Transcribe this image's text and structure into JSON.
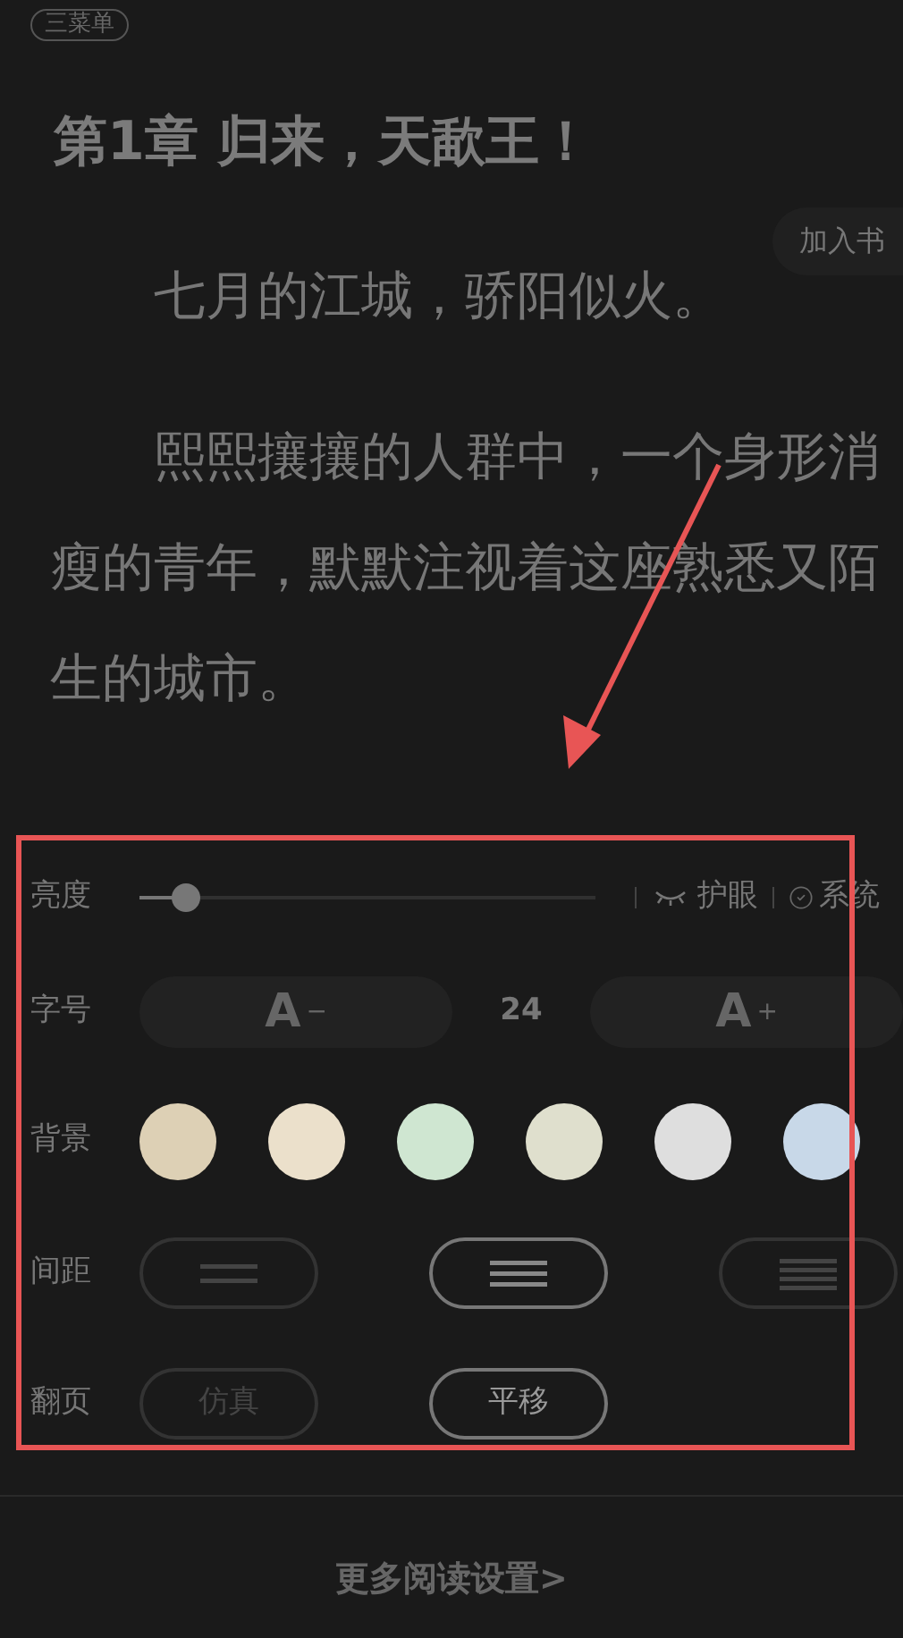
{
  "menu_button": {
    "label": "三菜单"
  },
  "chapter_title": "第1章 归来，天歃王！",
  "add_to_shelf_button": {
    "label": "加入书"
  },
  "paragraphs": [
    "七月的江城，骄阳似火。",
    "熙熙攘攘的人群中，一个身形消瘦的青年，默默注视着这座熟悉又陌生的城市。"
  ],
  "settings": {
    "brightness": {
      "label": "亮度",
      "level": 0.1,
      "eye_care": {
        "label": "护眼"
      },
      "system": {
        "label": "系统"
      }
    },
    "font_size": {
      "label": "字号",
      "decrease": {
        "letter": "A",
        "sign": "−"
      },
      "value": "24",
      "increase": {
        "letter": "A",
        "sign": "+"
      }
    },
    "background": {
      "label": "背景",
      "swatches": [
        {
          "color": "#ddd0b5"
        },
        {
          "color": "#ebe0cb"
        },
        {
          "color": "#cfe6d1"
        },
        {
          "color": "#dfdfcd"
        },
        {
          "color": "#dedede"
        },
        {
          "color": "#c8d8e8"
        }
      ]
    },
    "spacing": {
      "label": "间距",
      "options": [
        {
          "kind": "wide",
          "selected": false
        },
        {
          "kind": "medium",
          "selected": true
        },
        {
          "kind": "narrow",
          "selected": false
        }
      ]
    },
    "page_turn": {
      "label": "翻页",
      "options": [
        {
          "label": "仿真",
          "selected": false
        },
        {
          "label": "平移",
          "selected": true
        }
      ]
    }
  },
  "more_settings": "更多阅读设置>",
  "annotation": {
    "frame": true,
    "arrow": true
  }
}
